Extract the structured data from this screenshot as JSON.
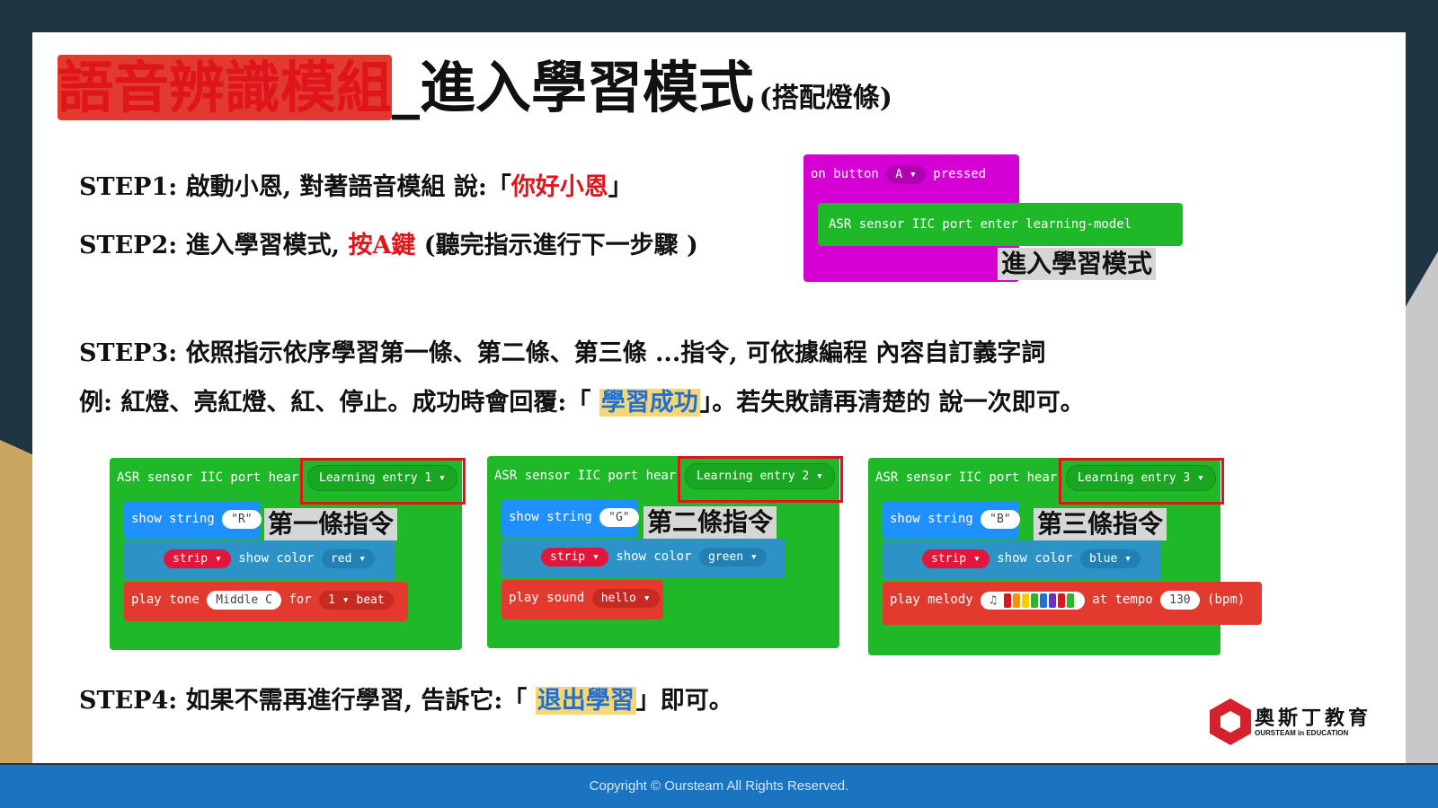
{
  "title": {
    "red_part": "語音辨識模組",
    "black_part": "_進入學習模式",
    "small_part": "(搭配燈條)"
  },
  "step1": {
    "prefix": "STEP1: 啟動小恩, 對著語音模組 說:「",
    "highlight": "你好小恩",
    "suffix": "」"
  },
  "step2": {
    "prefix": "STEP2: 進入學習模式, ",
    "highlight": "按A鍵",
    "suffix": " (聽完指示進行下一步驟 )"
  },
  "step3": {
    "line1": "STEP3: 依照指示依序學習第一條、第二條、第三條 ...指令, 可依據編程 內容自訂義字詞",
    "line2_prefix": "例: 紅燈、亮紅燈、紅、停止。成功時會回覆:「 ",
    "line2_highlight": "學習成功",
    "line2_suffix": "」。若失敗請再清楚的 說一次即可。"
  },
  "step4": {
    "prefix": "STEP4: 如果不需再進行學習, 告訴它:「 ",
    "highlight": "退出學習",
    "suffix": "」即可。"
  },
  "learning_block": {
    "event_on": "on button",
    "event_button": "A",
    "event_pressed": "pressed",
    "command": "ASR sensor IIC port enter learning-model",
    "overlay": "進入學習模式"
  },
  "entries": [
    {
      "hear": "ASR sensor IIC port hear",
      "entry": "Learning entry 1",
      "show_string": "show string",
      "string_value": "\"R\"",
      "strip": "strip",
      "show_color": "show color",
      "color": "red",
      "action_label": "play tone",
      "action_value": "Middle C",
      "for_label": "for",
      "beat_value": "1",
      "beat_label": "beat",
      "overlay": "第一條指令"
    },
    {
      "hear": "ASR sensor IIC port hear",
      "entry": "Learning entry 2",
      "show_string": "show string",
      "string_value": "\"G\"",
      "strip": "strip",
      "show_color": "show color",
      "color": "green",
      "action_label": "play sound",
      "action_value": "hello",
      "overlay": "第二條指令"
    },
    {
      "hear": "ASR sensor IIC port hear",
      "entry": "Learning entry 3",
      "show_string": "show string",
      "string_value": "\"B\"",
      "strip": "strip",
      "show_color": "show color",
      "color": "blue",
      "action_label": "play melody",
      "tempo_label": "at tempo",
      "tempo_value": "130",
      "bpm_label": "(bpm)",
      "overlay": "第三條指令"
    }
  ],
  "melody_colors": [
    "#e0141b",
    "#f59300",
    "#f5d000",
    "#2bb52b",
    "#1f6fd6",
    "#6a2fc0",
    "#e0141b",
    "#2bb52b"
  ],
  "logo": {
    "name": "奧斯丁教育",
    "sub": "OURSTEAM in EDUCATION"
  },
  "footer": "Copyright © Oursteam All Rights Reserved."
}
